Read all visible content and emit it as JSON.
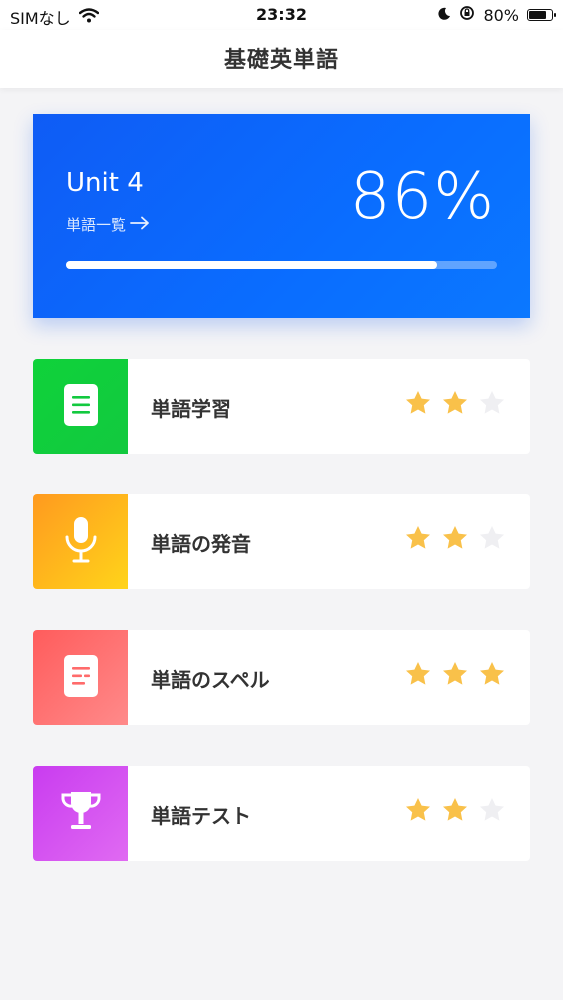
{
  "status_bar": {
    "carrier": "SIMなし",
    "time": "23:32",
    "battery_percent": "80%",
    "battery_level": 0.8
  },
  "nav": {
    "title": "基礎英単語"
  },
  "unit": {
    "title": "Unit 4",
    "link_label": "単語一覧",
    "percent_label": "86%",
    "progress": 0.86,
    "colors": {
      "card": "#0b6bff"
    }
  },
  "menu": [
    {
      "label": "単語学習",
      "icon": "document-icon",
      "color_from": "#0fd23a",
      "color_to": "#12c93f",
      "stars": 2,
      "max_stars": 3
    },
    {
      "label": "単語の発音",
      "icon": "microphone-icon",
      "color_from": "#ff9a1f",
      "color_to": "#ffd41a",
      "stars": 2,
      "max_stars": 3
    },
    {
      "label": "単語のスペル",
      "icon": "note-icon",
      "color_from": "#ff5c5c",
      "color_to": "#ff8a8a",
      "stars": 3,
      "max_stars": 3
    },
    {
      "label": "単語テスト",
      "icon": "trophy-icon",
      "color_from": "#c93cf0",
      "color_to": "#e06af2",
      "stars": 2,
      "max_stars": 3
    }
  ],
  "colors": {
    "star_on": "#f9c14a",
    "star_off": "#efeff2"
  }
}
